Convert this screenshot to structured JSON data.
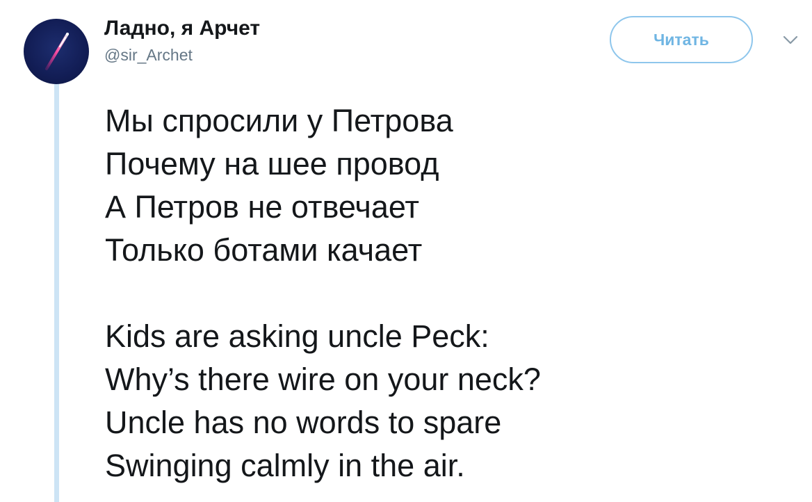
{
  "author": {
    "display_name": "Ладно, я Арчет",
    "handle": "@sir_Archet"
  },
  "follow_button": {
    "label": "Читать"
  },
  "tweet": {
    "stanzas": [
      {
        "lines": [
          "Мы спросили у Петрова",
          "Почему на шее провод",
          "А Петров не отвечает",
          "Только ботами качает"
        ]
      },
      {
        "lines": [
          "Kids are asking uncle Peck:",
          "Why’s there wire on your neck?",
          "Uncle has no words to spare",
          "Swinging calmly in the air."
        ]
      }
    ]
  },
  "icons": {
    "avatar": "rocket-streak-avatar",
    "menu": "chevron-down-icon"
  },
  "colors": {
    "accent": "#1da1f2",
    "button_border": "#8ec6ec",
    "thread_line": "#cde4f5",
    "text": "#14171a",
    "muted": "#657786"
  }
}
